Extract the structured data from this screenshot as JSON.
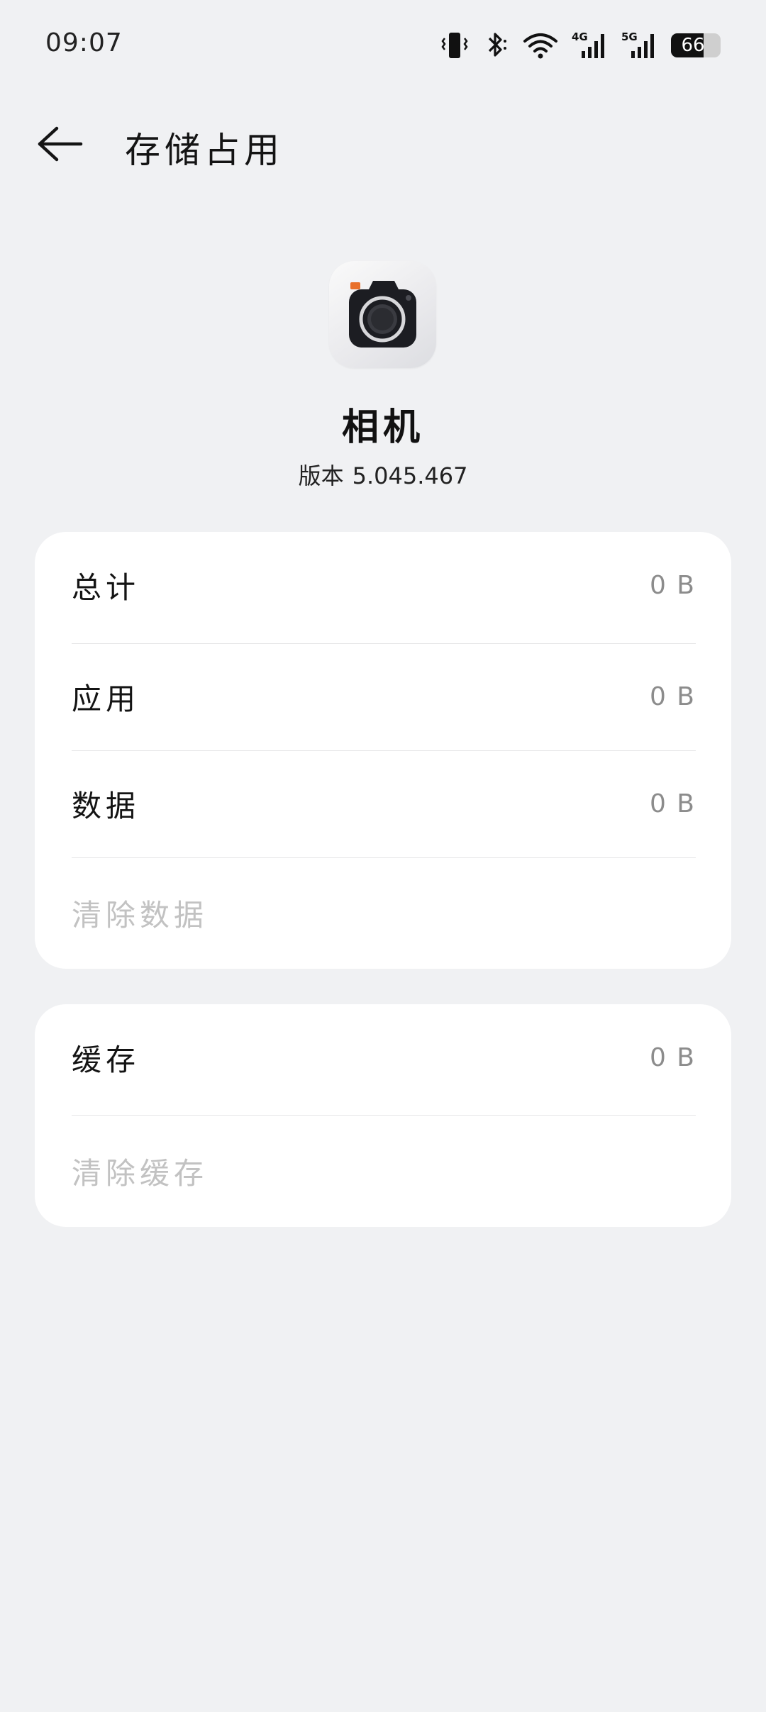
{
  "status_bar": {
    "time": "09:07",
    "icons": [
      "vibrate-icon",
      "bluetooth-icon",
      "wifi-icon",
      "signal-4g-icon",
      "signal-5g-icon"
    ],
    "network_4g": "4G",
    "network_5g": "5G",
    "battery_level": 66,
    "battery_text": "66"
  },
  "header": {
    "back_icon": "arrow-left-icon",
    "title": "存储占用"
  },
  "app": {
    "icon": "camera-icon",
    "name": "相机",
    "version_label": "版本",
    "version_number": "5.045.467"
  },
  "storage_card": {
    "rows": [
      {
        "label": "总计",
        "value": "0 B"
      },
      {
        "label": "应用",
        "value": "0 B"
      },
      {
        "label": "数据",
        "value": "0 B"
      }
    ],
    "action_label": "清除数据"
  },
  "cache_card": {
    "rows": [
      {
        "label": "缓存",
        "value": "0 B"
      }
    ],
    "action_label": "清除缓存"
  },
  "colors": {
    "background": "#f0f1f3",
    "card": "#ffffff",
    "disabled_text": "#c2c2c2",
    "value_text": "#8c8c8c",
    "camera_accent": "#e8702a"
  }
}
